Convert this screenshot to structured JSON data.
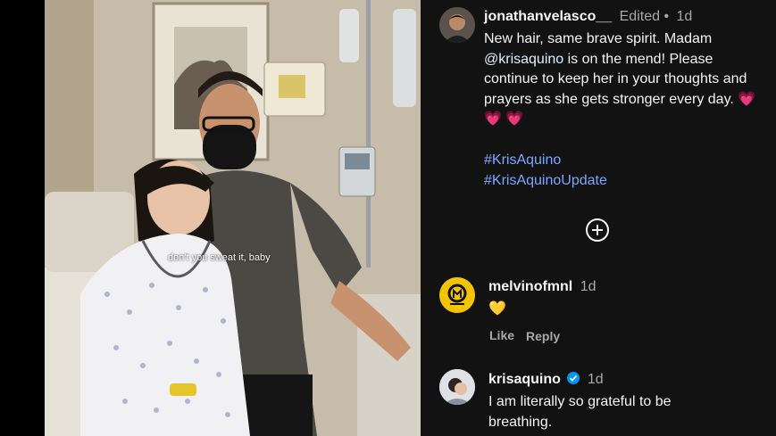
{
  "post": {
    "author": "jonathanvelasco__",
    "edited": "Edited",
    "dot": "•",
    "time": "1d",
    "caption_part1": "New hair, same brave spirit. Madam ",
    "mention": "@krisaquino",
    "caption_part2": " is on the mend! Please continue to keep her in your thoughts and prayers as she gets stronger every day. ",
    "emojis": "💗 💗 💗",
    "hashtags": [
      "#KrisAquino",
      "#KrisAquinoUpdate"
    ],
    "photo_overlay_text": "don't you sweat it, baby"
  },
  "comments": [
    {
      "user": "melvinofmnl",
      "time": "1d",
      "text": "💛",
      "like_label": "Like",
      "reply_label": "Reply"
    },
    {
      "user": "krisaquino",
      "time": "1d",
      "text": "I am literally so grateful to be breathing."
    }
  ],
  "colors": {
    "panel_bg": "#121212",
    "hashtag": "#7da6ff",
    "verified": "#0095f6"
  },
  "icons": {
    "load_more": "plus-circle-icon",
    "verified": "verified-badge-icon"
  }
}
